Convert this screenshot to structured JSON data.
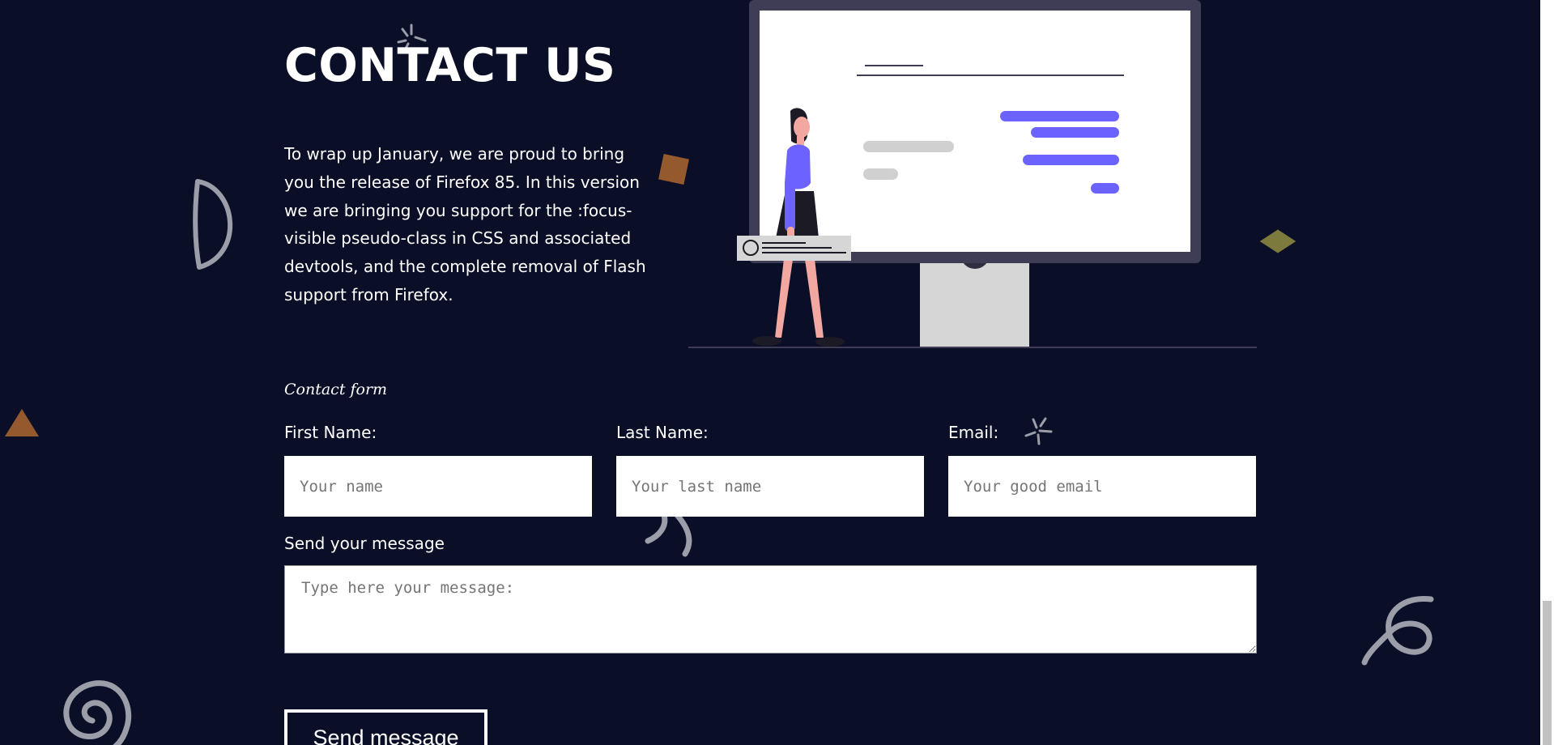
{
  "header": {
    "title": "CONTACT US"
  },
  "intro": {
    "text": "To wrap up January, we are proud to bring you the release of Firefox 85. In this version we are bringing you support for the :focus-visible pseudo-class in CSS and associated devtools, and the complete removal of Flash support from Firefox."
  },
  "form": {
    "caption": "Contact form",
    "first_name": {
      "label": "First Name:",
      "placeholder": "Your name",
      "value": ""
    },
    "last_name": {
      "label": "Last Name:",
      "placeholder": "Your last name",
      "value": ""
    },
    "email": {
      "label": "Email:",
      "placeholder": "Your good email",
      "value": ""
    },
    "message": {
      "label": "Send your message",
      "placeholder": "Type here your message:",
      "value": ""
    },
    "submit_label": "Send message"
  },
  "colors": {
    "background": "#0a0f27",
    "accent_purple": "#6c63ff",
    "deco_brown": "#94592c",
    "deco_olive": "#7c7a3c",
    "deco_gray": "#9b9ea8",
    "text": "#ffffff"
  },
  "icons": {
    "sparkle": "sparkle-icon",
    "squiggle": "squiggle-icon",
    "spiral": "spiral-icon",
    "curl": "curl-icon",
    "half_circle": "half-circle-icon"
  }
}
